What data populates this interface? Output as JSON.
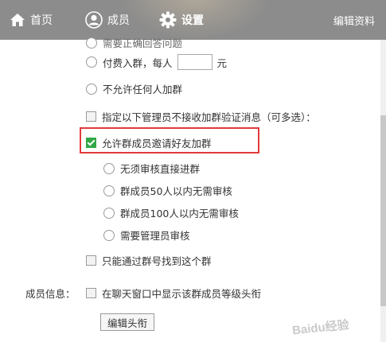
{
  "nav": {
    "home": "首页",
    "members": "成员",
    "settings": "设置",
    "edit_profile": "编辑资料"
  },
  "settings": {
    "clipped_option": "需要正确回答问题",
    "paid_prefix": "付费入群，每人",
    "paid_unit": "元",
    "paid_amount": "",
    "no_join": "不允许任何人加群",
    "admin_no_verify": "指定以下管理员不接收加群验证消息（可多选）：",
    "allow_invite": "允许群成员邀请好友加群",
    "invite_options": [
      "无须审核直接进群",
      "群成员50人以内无需审核",
      "群成员100人以内无需审核",
      "需要管理员审核"
    ],
    "find_by_number": "只能通过群号找到这个群",
    "member_info_label": "成员信息：",
    "show_level_title": "在聊天窗口中显示该群成员等级头衔",
    "edit_title_button": "编辑头衔"
  },
  "colors": {
    "topbar": "#8c8c8c",
    "highlight": "#e23a3a",
    "check": "#2fa845"
  },
  "watermark": "Baidu经验"
}
